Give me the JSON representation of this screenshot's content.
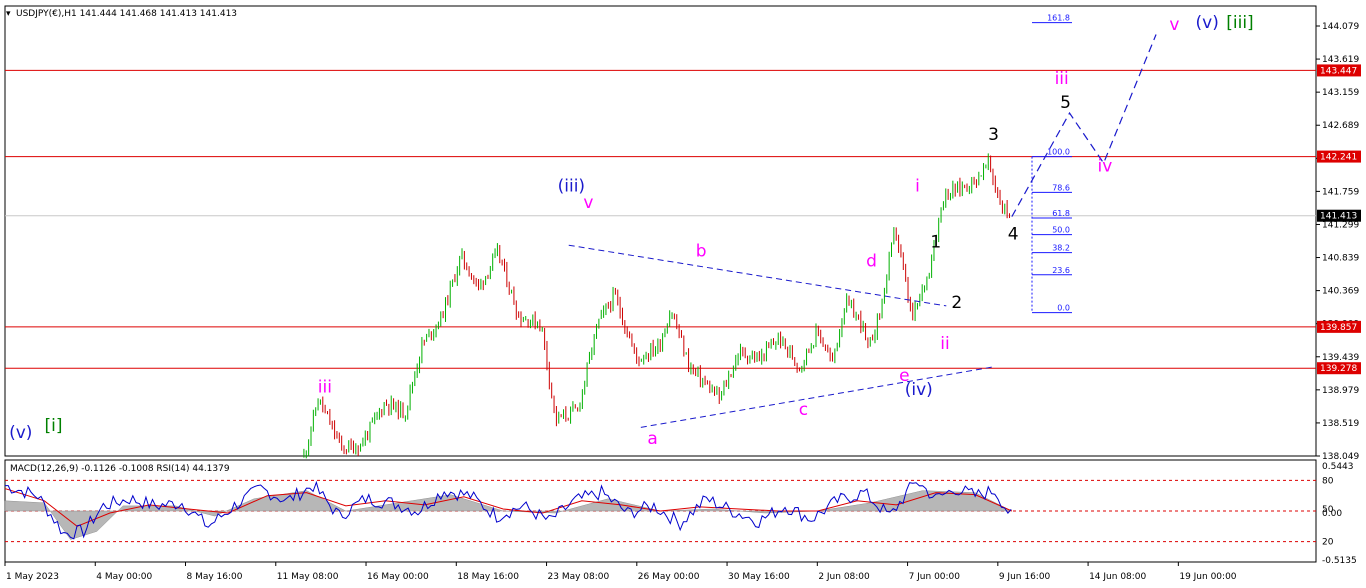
{
  "header": {
    "symbol_line": "USDJPY(€),H1  141.444 141.468 141.413 141.413",
    "indicator_line": "MACD(12,26,9) -0.1126 -0.1008 RSI(14) 44.1379"
  },
  "colors": {
    "bull_candle": "#00b000",
    "bear_candle": "#cc0000",
    "level_line": "#dd0000",
    "trend_line": "#1a1acc",
    "fib_line": "#1a1aff",
    "wave_magenta": "#ff00ff",
    "wave_blue": "#1a1acc",
    "wave_green": "#008000",
    "macd_hist": "#b0b0b0",
    "macd_signal": "#dd0000",
    "rsi_line": "#0000cc"
  },
  "chart_data": [
    {
      "type": "candlestick",
      "ylim": [
        138.049,
        144.349
      ],
      "y_ticks": [
        "144.079",
        "143.619",
        "143.159",
        "142.689",
        "142.229",
        "141.759",
        "141.299",
        "140.839",
        "140.369",
        "139.909",
        "139.439",
        "138.979",
        "138.519",
        "138.049"
      ],
      "x_ticks": [
        "1 May 2023",
        "4 May 00:00",
        "8 May 16:00",
        "11 May 08:00",
        "16 May 00:00",
        "18 May 16:00",
        "23 May 08:00",
        "26 May 00:00",
        "30 May 16:00",
        "2 Jun 08:00",
        "7 Jun 00:00",
        "9 Jun 16:00",
        "14 Jun 08:00",
        "19 Jun 00:00"
      ],
      "current_price": "141.413",
      "horizontal_levels": [
        {
          "value": 143.447,
          "label": "143.447"
        },
        {
          "value": 142.241,
          "label": "142.241"
        },
        {
          "value": 139.857,
          "label": "139.857"
        },
        {
          "value": 139.278,
          "label": "139.278"
        }
      ],
      "price_path": [
        {
          "t": 0.0,
          "p": 138.0
        },
        {
          "t": 0.228,
          "p": 138.05
        },
        {
          "t": 0.239,
          "p": 138.85
        },
        {
          "t": 0.257,
          "p": 138.15
        },
        {
          "t": 0.271,
          "p": 138.2
        },
        {
          "t": 0.29,
          "p": 138.8
        },
        {
          "t": 0.305,
          "p": 138.65
        },
        {
          "t": 0.318,
          "p": 139.6
        },
        {
          "t": 0.333,
          "p": 140.0
        },
        {
          "t": 0.348,
          "p": 140.85
        },
        {
          "t": 0.361,
          "p": 140.4
        },
        {
          "t": 0.376,
          "p": 140.9
        },
        {
          "t": 0.392,
          "p": 140.0
        },
        {
          "t": 0.409,
          "p": 139.9
        },
        {
          "t": 0.42,
          "p": 138.55
        },
        {
          "t": 0.437,
          "p": 138.7
        },
        {
          "t": 0.452,
          "p": 139.9
        },
        {
          "t": 0.465,
          "p": 140.3
        },
        {
          "t": 0.482,
          "p": 139.4
        },
        {
          "t": 0.499,
          "p": 139.6
        },
        {
          "t": 0.508,
          "p": 140.1
        },
        {
          "t": 0.522,
          "p": 139.3
        },
        {
          "t": 0.545,
          "p": 138.85
        },
        {
          "t": 0.56,
          "p": 139.5
        },
        {
          "t": 0.575,
          "p": 139.4
        },
        {
          "t": 0.59,
          "p": 139.7
        },
        {
          "t": 0.606,
          "p": 139.3
        },
        {
          "t": 0.62,
          "p": 139.8
        },
        {
          "t": 0.631,
          "p": 139.35
        },
        {
          "t": 0.641,
          "p": 140.2
        },
        {
          "t": 0.654,
          "p": 139.9
        },
        {
          "t": 0.658,
          "p": 139.5
        },
        {
          "t": 0.668,
          "p": 140.1
        },
        {
          "t": 0.679,
          "p": 141.25
        },
        {
          "t": 0.692,
          "p": 139.95
        },
        {
          "t": 0.704,
          "p": 140.6
        },
        {
          "t": 0.716,
          "p": 141.7
        },
        {
          "t": 0.728,
          "p": 141.8
        },
        {
          "t": 0.74,
          "p": 141.9
        },
        {
          "t": 0.75,
          "p": 142.15
        },
        {
          "t": 0.76,
          "p": 141.55
        },
        {
          "t": 0.768,
          "p": 141.41
        }
      ],
      "projection_path": [
        {
          "t": 0.768,
          "p": 141.4
        },
        {
          "t": 0.812,
          "p": 142.85
        },
        {
          "t": 0.838,
          "p": 142.15
        },
        {
          "t": 0.878,
          "p": 143.95
        }
      ],
      "triangle_lines": [
        {
          "from": {
            "t": 0.43,
            "p": 141.0
          },
          "to": {
            "t": 0.718,
            "p": 140.15
          }
        },
        {
          "from": {
            "t": 0.485,
            "p": 138.45
          },
          "to": {
            "t": 0.755,
            "p": 139.3
          }
        }
      ],
      "fibonacci": [
        {
          "value": 142.241,
          "label": "100.0"
        },
        {
          "value": 141.739,
          "label": "78.6"
        },
        {
          "value": 141.381,
          "label": "61.8"
        },
        {
          "value": 141.149,
          "label": "50.0"
        },
        {
          "value": 140.896,
          "label": "38.2"
        },
        {
          "value": 140.586,
          "label": "23.6"
        },
        {
          "value": 140.057,
          "label": "0.0"
        },
        {
          "value": 144.117,
          "label": "161.8"
        }
      ],
      "wave_labels": [
        {
          "text": "(v)",
          "t": 0.012,
          "p": 138.3,
          "color": "wave_blue"
        },
        {
          "text": "[i]",
          "t": 0.037,
          "p": 138.4,
          "color": "wave_green"
        },
        {
          "text": "iii",
          "t": 0.244,
          "p": 138.94,
          "color": "wave_magenta"
        },
        {
          "text": "(iii)",
          "t": 0.432,
          "p": 141.75,
          "color": "wave_blue"
        },
        {
          "text": "v",
          "t": 0.445,
          "p": 141.52,
          "color": "wave_magenta"
        },
        {
          "text": "b",
          "t": 0.531,
          "p": 140.84,
          "color": "wave_magenta"
        },
        {
          "text": "d",
          "t": 0.661,
          "p": 140.7,
          "color": "wave_magenta"
        },
        {
          "text": "a",
          "t": 0.494,
          "p": 138.22,
          "color": "wave_magenta"
        },
        {
          "text": "c",
          "t": 0.609,
          "p": 138.62,
          "color": "wave_magenta"
        },
        {
          "text": "e",
          "t": 0.686,
          "p": 139.1,
          "color": "wave_magenta"
        },
        {
          "text": "(iv)",
          "t": 0.697,
          "p": 138.9,
          "color": "wave_blue"
        },
        {
          "text": "i",
          "t": 0.696,
          "p": 141.75,
          "color": "wave_magenta"
        },
        {
          "text": "ii",
          "t": 0.717,
          "p": 139.55,
          "color": "wave_magenta"
        },
        {
          "text": "1",
          "t": 0.71,
          "p": 140.97,
          "color": "black"
        },
        {
          "text": "2",
          "t": 0.726,
          "p": 140.12,
          "color": "black"
        },
        {
          "text": "3",
          "t": 0.754,
          "p": 142.47,
          "color": "black"
        },
        {
          "text": "4",
          "t": 0.769,
          "p": 141.08,
          "color": "black"
        },
        {
          "text": "5",
          "t": 0.809,
          "p": 142.92,
          "color": "black"
        },
        {
          "text": "iii",
          "t": 0.806,
          "p": 143.26,
          "color": "wave_magenta"
        },
        {
          "text": "iv",
          "t": 0.839,
          "p": 142.03,
          "color": "wave_magenta"
        },
        {
          "text": "v",
          "t": 0.892,
          "p": 144.01,
          "color": "wave_magenta"
        },
        {
          "text": "(v)",
          "t": 0.917,
          "p": 144.04,
          "color": "wave_blue"
        },
        {
          "text": "[iii]",
          "t": 0.942,
          "p": 144.04,
          "color": "wave_green"
        }
      ]
    },
    {
      "type": "line",
      "indicators": [
        "MACD(12,26,9)",
        "RSI(14)"
      ],
      "ylim": [
        0,
        100
      ],
      "y_ticks": [
        "0.5443",
        "80",
        "50",
        "0.00",
        "20",
        "-0.5135"
      ],
      "rsi_levels": [
        80,
        50,
        20
      ],
      "rsi_path": [
        {
          "t": 0.0,
          "v": 75
        },
        {
          "t": 0.025,
          "v": 65
        },
        {
          "t": 0.045,
          "v": 28
        },
        {
          "t": 0.06,
          "v": 30
        },
        {
          "t": 0.075,
          "v": 55
        },
        {
          "t": 0.095,
          "v": 62
        },
        {
          "t": 0.115,
          "v": 55
        },
        {
          "t": 0.135,
          "v": 58
        },
        {
          "t": 0.155,
          "v": 35
        },
        {
          "t": 0.175,
          "v": 55
        },
        {
          "t": 0.195,
          "v": 72
        },
        {
          "t": 0.215,
          "v": 60
        },
        {
          "t": 0.235,
          "v": 75
        },
        {
          "t": 0.255,
          "v": 45
        },
        {
          "t": 0.275,
          "v": 62
        },
        {
          "t": 0.295,
          "v": 58
        },
        {
          "t": 0.315,
          "v": 50
        },
        {
          "t": 0.335,
          "v": 70
        },
        {
          "t": 0.355,
          "v": 65
        },
        {
          "t": 0.375,
          "v": 45
        },
        {
          "t": 0.395,
          "v": 55
        },
        {
          "t": 0.415,
          "v": 40
        },
        {
          "t": 0.435,
          "v": 60
        },
        {
          "t": 0.455,
          "v": 68
        },
        {
          "t": 0.475,
          "v": 48
        },
        {
          "t": 0.495,
          "v": 55
        },
        {
          "t": 0.515,
          "v": 38
        },
        {
          "t": 0.535,
          "v": 62
        },
        {
          "t": 0.555,
          "v": 50
        },
        {
          "t": 0.575,
          "v": 40
        },
        {
          "t": 0.595,
          "v": 55
        },
        {
          "t": 0.615,
          "v": 42
        },
        {
          "t": 0.635,
          "v": 60
        },
        {
          "t": 0.655,
          "v": 68
        },
        {
          "t": 0.675,
          "v": 45
        },
        {
          "t": 0.695,
          "v": 80
        },
        {
          "t": 0.71,
          "v": 62
        },
        {
          "t": 0.725,
          "v": 72
        },
        {
          "t": 0.74,
          "v": 65
        },
        {
          "t": 0.755,
          "v": 70
        },
        {
          "t": 0.768,
          "v": 44
        }
      ],
      "signal_path": [
        {
          "t": 0.0,
          "v": 72
        },
        {
          "t": 0.03,
          "v": 60
        },
        {
          "t": 0.055,
          "v": 35
        },
        {
          "t": 0.08,
          "v": 48
        },
        {
          "t": 0.11,
          "v": 56
        },
        {
          "t": 0.14,
          "v": 52
        },
        {
          "t": 0.17,
          "v": 48
        },
        {
          "t": 0.2,
          "v": 65
        },
        {
          "t": 0.23,
          "v": 68
        },
        {
          "t": 0.26,
          "v": 55
        },
        {
          "t": 0.29,
          "v": 60
        },
        {
          "t": 0.32,
          "v": 56
        },
        {
          "t": 0.35,
          "v": 64
        },
        {
          "t": 0.38,
          "v": 52
        },
        {
          "t": 0.41,
          "v": 48
        },
        {
          "t": 0.44,
          "v": 60
        },
        {
          "t": 0.47,
          "v": 56
        },
        {
          "t": 0.5,
          "v": 50
        },
        {
          "t": 0.53,
          "v": 54
        },
        {
          "t": 0.56,
          "v": 52
        },
        {
          "t": 0.59,
          "v": 50
        },
        {
          "t": 0.62,
          "v": 50
        },
        {
          "t": 0.65,
          "v": 60
        },
        {
          "t": 0.68,
          "v": 56
        },
        {
          "t": 0.71,
          "v": 68
        },
        {
          "t": 0.74,
          "v": 66
        },
        {
          "t": 0.768,
          "v": 50
        }
      ],
      "hist_path": [
        {
          "t": 0.0,
          "v": 60
        },
        {
          "t": 0.03,
          "v": 58
        },
        {
          "t": 0.05,
          "v": 22
        },
        {
          "t": 0.07,
          "v": 30
        },
        {
          "t": 0.09,
          "v": 55
        },
        {
          "t": 0.13,
          "v": 55
        },
        {
          "t": 0.16,
          "v": 45
        },
        {
          "t": 0.19,
          "v": 62
        },
        {
          "t": 0.23,
          "v": 70
        },
        {
          "t": 0.26,
          "v": 50
        },
        {
          "t": 0.3,
          "v": 58
        },
        {
          "t": 0.34,
          "v": 66
        },
        {
          "t": 0.38,
          "v": 50
        },
        {
          "t": 0.42,
          "v": 48
        },
        {
          "t": 0.46,
          "v": 62
        },
        {
          "t": 0.5,
          "v": 50
        },
        {
          "t": 0.54,
          "v": 52
        },
        {
          "t": 0.58,
          "v": 48
        },
        {
          "t": 0.62,
          "v": 50
        },
        {
          "t": 0.66,
          "v": 58
        },
        {
          "t": 0.7,
          "v": 70
        },
        {
          "t": 0.74,
          "v": 68
        },
        {
          "t": 0.768,
          "v": 50
        }
      ]
    }
  ]
}
